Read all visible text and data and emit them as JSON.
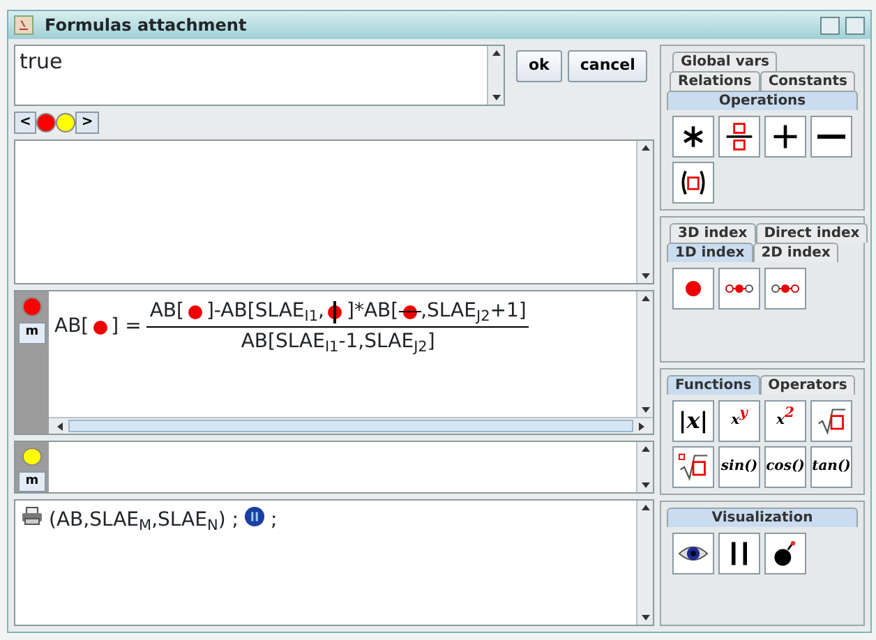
{
  "window": {
    "title": "Formulas attachment"
  },
  "condition": {
    "value": "true"
  },
  "buttons": [
    "ok",
    "cancel"
  ],
  "navigator": {
    "prev": "<",
    "next": ">",
    "markers": [
      {
        "color": "#ff0000"
      },
      {
        "color": "#ffff00"
      }
    ]
  },
  "formulas": [
    {
      "color": "#ff0000",
      "button": "m",
      "lhs": [
        {
          "kind": "text",
          "text": "AB["
        },
        {
          "kind": "slot"
        },
        {
          "kind": "text",
          "text": "] ="
        }
      ],
      "numerator": [
        {
          "kind": "text",
          "text": "AB["
        },
        {
          "kind": "slot"
        },
        {
          "kind": "text",
          "text": "]-AB[SLAE$_{I1}$,"
        },
        {
          "kind": "slot-v"
        },
        {
          "kind": "text",
          "text": "]*AB["
        },
        {
          "kind": "slot-h"
        },
        {
          "kind": "text",
          "text": ",SLAE$_{J2}$+1]"
        }
      ],
      "denominator": [
        {
          "kind": "text",
          "text": "AB[SLAE$_{I1}$-1,SLAE$_{J2}$]"
        }
      ]
    },
    {
      "color": "#ffff00",
      "button": "m"
    }
  ],
  "output": [
    {
      "kind": "printer"
    },
    {
      "kind": "text",
      "text": "(AB,SLAE$_{M}$,SLAE$_{N}$) ;"
    },
    {
      "kind": "pause"
    },
    {
      "kind": "text",
      "text": ";"
    }
  ],
  "palettes": [
    {
      "tab_rows": [
        [
          {
            "label": "Global vars",
            "selected": false
          }
        ],
        [
          {
            "label": "Relations",
            "selected": false
          },
          {
            "label": "Constants",
            "selected": false
          }
        ],
        [
          {
            "label": "Operations",
            "selected": true
          }
        ]
      ],
      "tools": [
        {
          "kind": "asterisk"
        },
        {
          "kind": "fraction"
        },
        {
          "kind": "plus"
        },
        {
          "kind": "minus"
        },
        {
          "kind": "parens"
        }
      ]
    },
    {
      "tab_rows": [
        [
          {
            "label": "3D index",
            "selected": false
          },
          {
            "label": "Direct index",
            "selected": false
          }
        ],
        [
          {
            "label": "1D index",
            "selected": true
          },
          {
            "label": "2D index",
            "selected": false
          }
        ]
      ],
      "tools": [
        {
          "kind": "dot"
        },
        {
          "kind": "dots-left"
        },
        {
          "kind": "dots-right"
        }
      ]
    },
    {
      "tab_rows": [
        [
          {
            "label": "Functions",
            "selected": true
          },
          {
            "label": "Operators",
            "selected": false
          }
        ]
      ],
      "tools": [
        {
          "kind": "text",
          "text": "|x|"
        },
        {
          "kind": "text",
          "text": "x$^{y}$"
        },
        {
          "kind": "text",
          "text": "x$^{2}$"
        },
        {
          "kind": "sqrt"
        },
        {
          "kind": "root"
        },
        {
          "kind": "text",
          "text": "sin()"
        },
        {
          "kind": "text",
          "text": "cos()"
        },
        {
          "kind": "text",
          "text": "tan()"
        }
      ]
    },
    {
      "tab_rows": [
        [
          {
            "label": "Visualization",
            "selected": true
          }
        ]
      ],
      "tools": [
        {
          "kind": "eye"
        },
        {
          "kind": "pause-bars"
        },
        {
          "kind": "bomb"
        }
      ]
    }
  ]
}
